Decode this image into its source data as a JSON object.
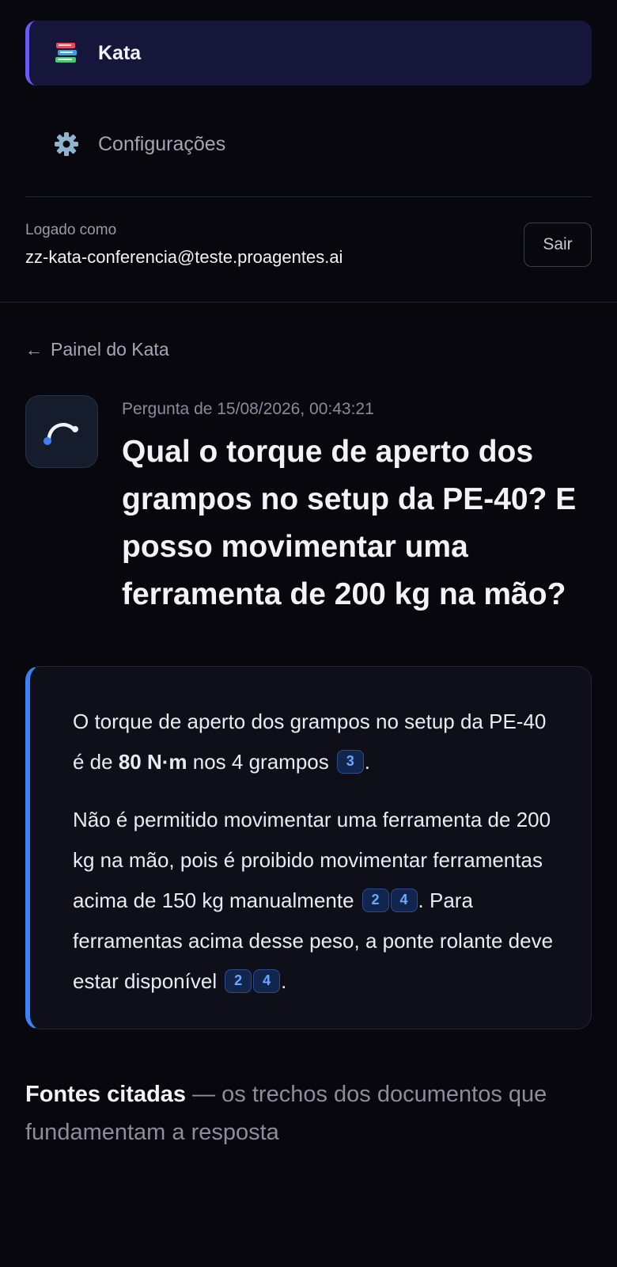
{
  "nav": {
    "kata_label": "Kata",
    "kata_icon": "books-icon",
    "settings_label": "Configurações",
    "settings_icon": "gear-icon"
  },
  "user": {
    "label": "Logado como",
    "email": "zz-kata-conferencia@teste.proagentes.ai",
    "logout_label": "Sair"
  },
  "back": {
    "arrow": "←",
    "label": "Painel do Kata"
  },
  "question": {
    "meta": "Pergunta de 15/08/2026, 00:43:21",
    "title": "Qual o torque de aperto dos grampos no setup da PE-40? E posso movimentar uma ferramenta de 200 kg na mão?"
  },
  "answer": {
    "p1_a": "O torque de aperto dos grampos no setup da PE-40 é de ",
    "p1_bold": "80 N·m",
    "p1_b": " nos 4 grampos",
    "p1_cite": "3",
    "p1_end": ".",
    "p2_a": "Não é permitido movimentar uma ferramenta de 200 kg na mão, pois é proibido movimentar ferramentas acima de 150 kg manualmente",
    "p2_cite1": "2",
    "p2_cite2": "4",
    "p2_b": ". Para ferramentas acima desse peso, a ponte rolante deve estar disponível",
    "p2_cite3": "2",
    "p2_cite4": "4",
    "p2_end": "."
  },
  "sources": {
    "title": "Fontes citadas",
    "subtitle": " — os trechos dos documentos que fundamentam a resposta"
  },
  "colors": {
    "accent_purple": "#6a5cf0",
    "accent_blue": "#3b82f6",
    "background": "#07070d"
  }
}
